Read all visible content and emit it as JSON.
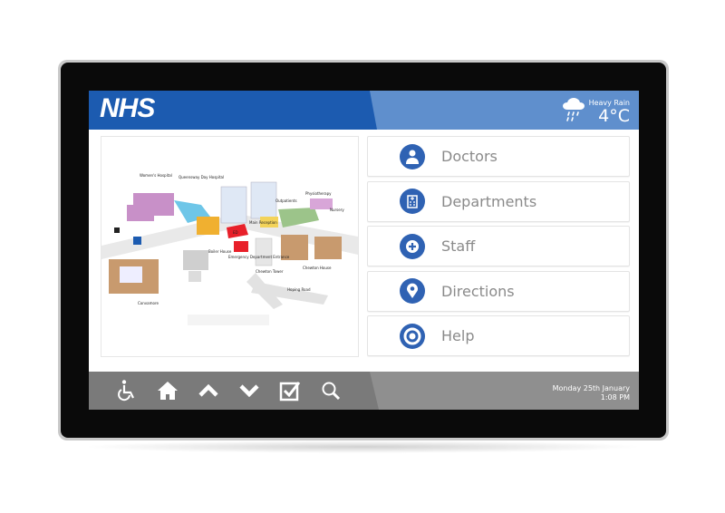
{
  "header": {
    "logo": "NHS",
    "weather": {
      "condition": "Heavy Rain",
      "temperature": "4°C",
      "icon": "cloud-rain-icon"
    }
  },
  "map": {
    "labels": [
      "Women's Hospital",
      "Queensway Day Hospital",
      "Outpatients",
      "Physiotherapy",
      "Main Reception",
      "ED",
      "Emergency Department Entrance",
      "Boiler House",
      "Chewton Tower",
      "Chewton House",
      "Convamore",
      "Nursery",
      "Hoping Road"
    ]
  },
  "menu": {
    "items": [
      {
        "label": "Doctors",
        "icon": "doctor-icon"
      },
      {
        "label": "Departments",
        "icon": "hospital-building-icon"
      },
      {
        "label": "Staff",
        "icon": "medical-cross-icon"
      },
      {
        "label": "Directions",
        "icon": "map-pin-icon"
      },
      {
        "label": "Help",
        "icon": "lifebuoy-icon"
      }
    ]
  },
  "footer": {
    "icons": [
      "wheelchair-icon",
      "home-icon",
      "chevron-up-icon",
      "chevron-down-icon",
      "checkbox-icon",
      "search-icon"
    ],
    "date": "Monday 25th January",
    "time": "1:08 PM"
  },
  "colors": {
    "nhs_blue": "#1c5bb0",
    "icon_blue": "#2f62b3",
    "footer_gray": "#7a7a7a"
  }
}
